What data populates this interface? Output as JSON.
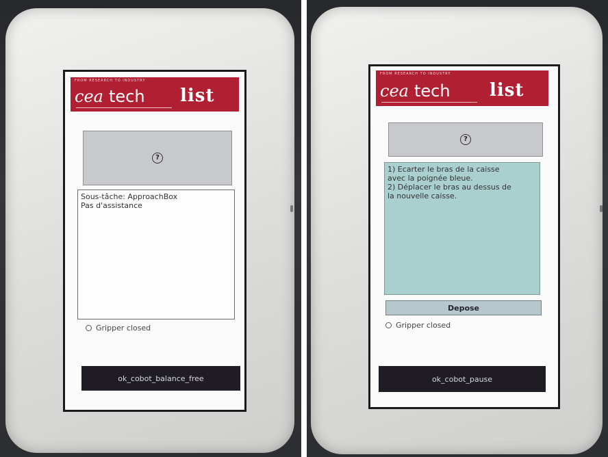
{
  "banner": {
    "tagline": "FROM RESEARCH TO INDUSTRY",
    "logo_cea": "cea",
    "logo_tech": "tech",
    "logo_list": "list"
  },
  "left_screen": {
    "help_symbol": "?",
    "message": "Sous-tâche: ApproachBox\nPas d'assistance",
    "gripper_label": "Gripper closed",
    "action_button": "ok_cobot_balance_free"
  },
  "right_screen": {
    "help_symbol": "?",
    "message": "1) Ecarter le bras de la caisse\navec la poignée bleue.\n2) Déplacer le bras au dessus de\nla nouvelle caisse.",
    "depose_button": "Depose",
    "gripper_label": "Gripper closed",
    "action_button": "ok_cobot_pause"
  },
  "colors": {
    "banner_red": "#b11f32",
    "message_highlight": "#a9cfcf",
    "action_dark": "#1f1c24"
  }
}
